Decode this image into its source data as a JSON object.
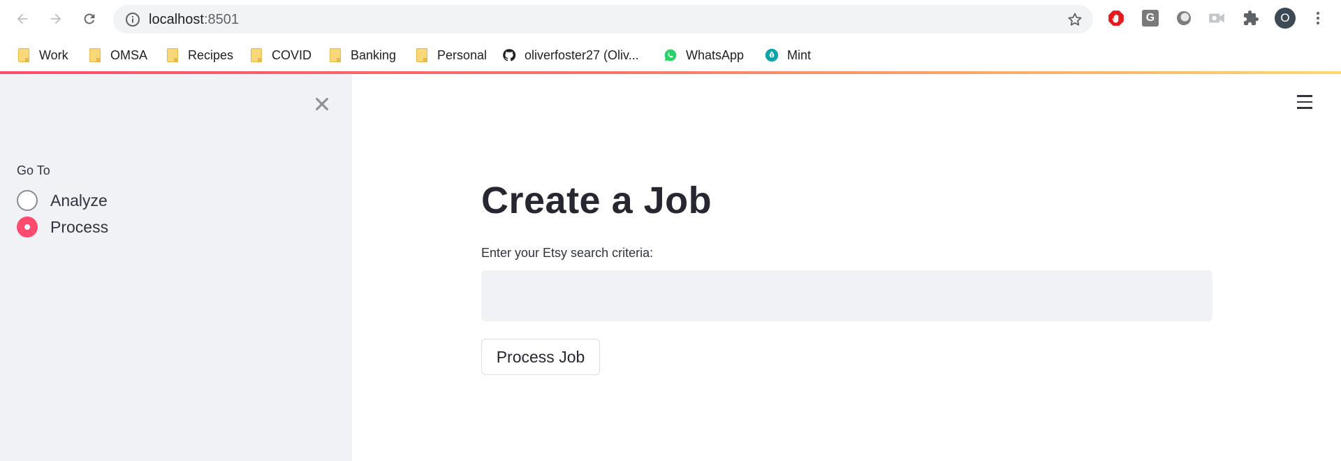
{
  "browser": {
    "url_host": "localhost",
    "url_port": ":8501",
    "profile_initial": "O",
    "extension_g_label": "G"
  },
  "bookmarks": [
    {
      "label": "Work",
      "icon": "folder-icon"
    },
    {
      "label": "OMSA",
      "icon": "folder-icon"
    },
    {
      "label": "Recipes",
      "icon": "folder-icon"
    },
    {
      "label": "COVID",
      "icon": "folder-icon"
    },
    {
      "label": "Banking",
      "icon": "folder-icon"
    },
    {
      "label": "Personal",
      "icon": "folder-icon"
    },
    {
      "label": "oliverfoster27 (Oliv...",
      "icon": "github-icon"
    },
    {
      "label": "WhatsApp",
      "icon": "whatsapp-icon"
    },
    {
      "label": "Mint",
      "icon": "mint-icon"
    }
  ],
  "sidebar": {
    "goto_label": "Go To",
    "options": [
      {
        "label": "Analyze",
        "checked": false
      },
      {
        "label": "Process",
        "checked": true
      }
    ]
  },
  "main": {
    "title": "Create a Job",
    "input_label": "Enter your Etsy search criteria:",
    "input_value": "",
    "button_label": "Process Job"
  },
  "colors": {
    "accent": "#ff4b6e",
    "sidebar_bg": "#f0f2f6",
    "input_bg": "#f0f2f6"
  }
}
